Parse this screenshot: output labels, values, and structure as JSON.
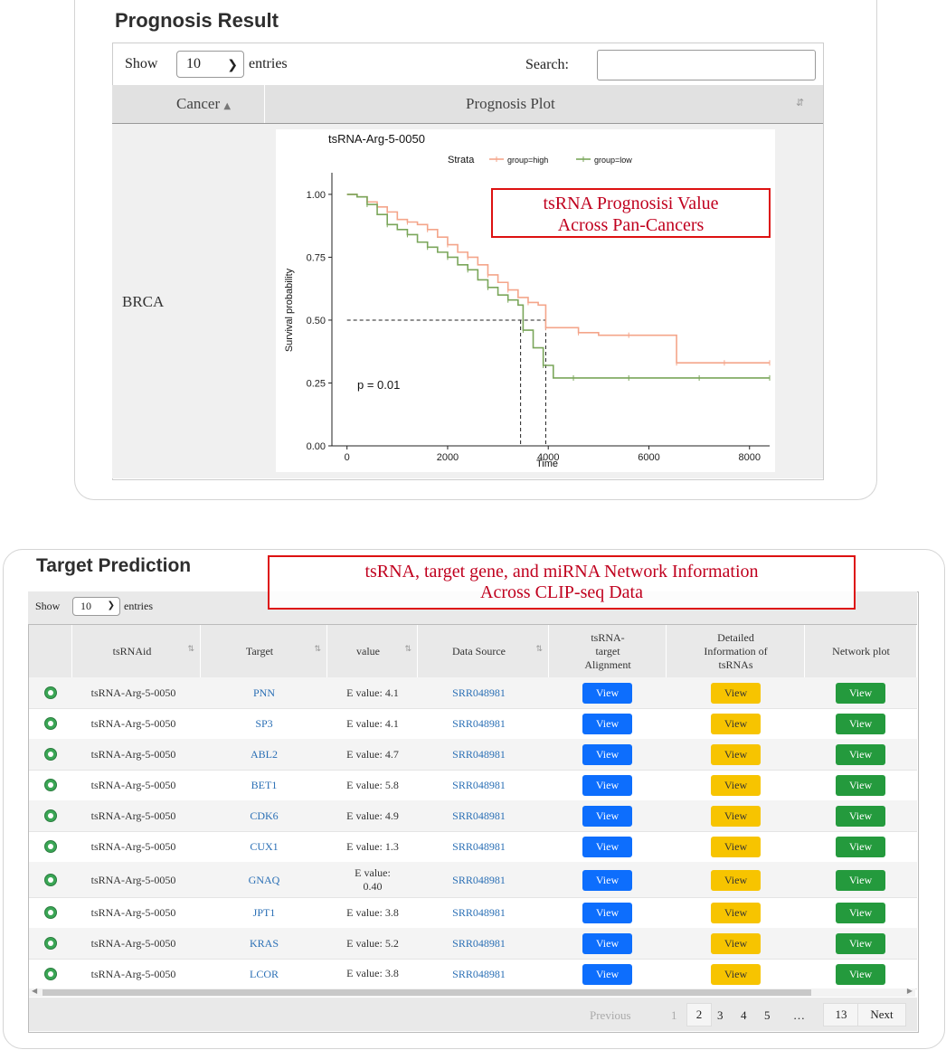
{
  "prognosis": {
    "title": "Prognosis Result",
    "show_label": "Show",
    "entries_value": "10",
    "entries_label": "entries",
    "search_label": "Search:",
    "search_value": "",
    "col_cancer": "Cancer",
    "col_plot": "Prognosis Plot",
    "row_cancer": "BRCA"
  },
  "callouts": {
    "prognosis": [
      "tsRNA Prognosisi Value",
      "Across Pan-Cancers"
    ],
    "target": [
      "tsRNA, target gene, and miRNA Network Information",
      "Across CLIP-seq Data"
    ]
  },
  "chart_data": {
    "type": "line",
    "title": "tsRNA-Arg-5-0050",
    "xlabel": "Time",
    "ylabel": "Survival probability",
    "xlim": [
      -300,
      8400
    ],
    "ylim": [
      0,
      1.05
    ],
    "xticks": [
      "0",
      "2000",
      "4000",
      "6000",
      "8000"
    ],
    "yticks": [
      "0.00",
      "0.25",
      "0.50",
      "0.75",
      "1.00"
    ],
    "legend_title": "Strata",
    "legend_position": "top",
    "annotation": "p = 0.01",
    "median_lines": [
      3450,
      3950
    ],
    "series": [
      {
        "name": "group=high",
        "color": "#f4a58a",
        "x": [
          0,
          200,
          400,
          600,
          800,
          1000,
          1200,
          1400,
          1600,
          1800,
          2000,
          2200,
          2400,
          2600,
          2800,
          3000,
          3200,
          3400,
          3600,
          3800,
          3950,
          4200,
          4600,
          5000,
          5600,
          6300,
          6550,
          7000,
          7500,
          8000,
          8400
        ],
        "y": [
          1.0,
          0.99,
          0.97,
          0.95,
          0.93,
          0.9,
          0.89,
          0.88,
          0.86,
          0.83,
          0.8,
          0.77,
          0.75,
          0.72,
          0.68,
          0.65,
          0.62,
          0.59,
          0.57,
          0.56,
          0.47,
          0.47,
          0.45,
          0.44,
          0.44,
          0.44,
          0.33,
          0.33,
          0.33,
          0.33,
          0.33
        ]
      },
      {
        "name": "group=low",
        "color": "#7aa65a",
        "x": [
          0,
          200,
          400,
          600,
          800,
          1000,
          1200,
          1400,
          1600,
          1800,
          2000,
          2200,
          2400,
          2600,
          2800,
          3000,
          3200,
          3400,
          3500,
          3700,
          3900,
          4100,
          4500,
          5000,
          5600,
          6200,
          7000,
          8000,
          8400
        ],
        "y": [
          1.0,
          0.99,
          0.96,
          0.92,
          0.88,
          0.86,
          0.84,
          0.81,
          0.79,
          0.77,
          0.75,
          0.72,
          0.7,
          0.66,
          0.63,
          0.6,
          0.58,
          0.56,
          0.46,
          0.39,
          0.32,
          0.27,
          0.27,
          0.27,
          0.27,
          0.27,
          0.27,
          0.27,
          0.27
        ]
      }
    ]
  },
  "target": {
    "title": "Target Prediction",
    "show_label": "Show",
    "entries_value": "10",
    "entries_label": "entries",
    "columns": [
      "tsRNAid",
      "Target",
      "value",
      "Data Source",
      "tsRNA-\ntarget\nAlignment",
      "Detailed\nInformation of\ntsRNAs",
      "Network plot"
    ],
    "button_label": "View",
    "rows": [
      {
        "id": "tsRNA-Arg-5-0050",
        "target": "PNN",
        "value": "E value: 4.1",
        "source": "SRR048981"
      },
      {
        "id": "tsRNA-Arg-5-0050",
        "target": "SP3",
        "value": "E value: 4.1",
        "source": "SRR048981"
      },
      {
        "id": "tsRNA-Arg-5-0050",
        "target": "ABL2",
        "value": "E value: 4.7",
        "source": "SRR048981"
      },
      {
        "id": "tsRNA-Arg-5-0050",
        "target": "BET1",
        "value": "E value: 5.8",
        "source": "SRR048981"
      },
      {
        "id": "tsRNA-Arg-5-0050",
        "target": "CDK6",
        "value": "E value: 4.9",
        "source": "SRR048981"
      },
      {
        "id": "tsRNA-Arg-5-0050",
        "target": "CUX1",
        "value": "E value: 1.3",
        "source": "SRR048981"
      },
      {
        "id": "tsRNA-Arg-5-0050",
        "target": "GNAQ",
        "value": "E value:\n0.40",
        "source": "SRR048981"
      },
      {
        "id": "tsRNA-Arg-5-0050",
        "target": "JPT1",
        "value": "E value: 3.8",
        "source": "SRR048981"
      },
      {
        "id": "tsRNA-Arg-5-0050",
        "target": "KRAS",
        "value": "E value: 5.2",
        "source": "SRR048981"
      },
      {
        "id": "tsRNA-Arg-5-0050",
        "target": "LCOR",
        "value": "E value: 3.8",
        "source": "SRR048981"
      }
    ],
    "pager": {
      "previous": "Previous",
      "pages": [
        "1",
        "2",
        "3",
        "4",
        "5"
      ],
      "ellipsis": "…",
      "last": "13",
      "next": "Next"
    }
  },
  "colors": {
    "callout_red": "#d11111",
    "btn_blue": "#0d6efd",
    "btn_yellow": "#f7c400",
    "btn_green": "#249a3d",
    "link_blue": "#2a6fb5"
  }
}
